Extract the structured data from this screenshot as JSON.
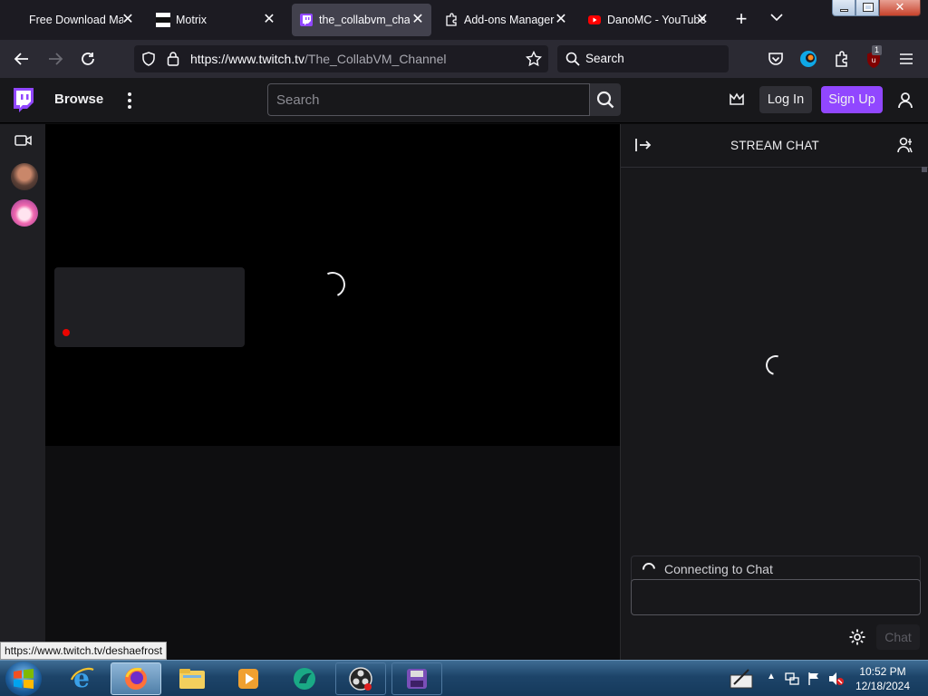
{
  "browser": {
    "tabs": [
      {
        "title": "Free Download Ma",
        "active": false
      },
      {
        "title": "Motrix",
        "active": false
      },
      {
        "title": "the_collabvm_chan",
        "active": true
      },
      {
        "title": "Add-ons Manager",
        "active": false
      },
      {
        "title": "DanoMC - YouTube",
        "active": false
      }
    ],
    "close_glyph": "✕",
    "new_tab_glyph": "+",
    "url_domain": "https://www.twitch.tv",
    "url_path": "/The_CollabVM_Channel",
    "search_label": "Search",
    "extension_badge": "1",
    "status_url": "https://www.twitch.tv/deshaefrost"
  },
  "twitch": {
    "browse_label": "Browse",
    "search_placeholder": "Search",
    "login_label": "Log In",
    "signup_label": "Sign Up",
    "accent_color": "#9147ff"
  },
  "chat": {
    "title": "STREAM CHAT",
    "connecting_text": "Connecting to Chat",
    "chat_button": "Chat"
  },
  "taskbar": {
    "time": "10:52 PM",
    "date": "12/18/2024"
  },
  "icons": [
    "back-arrow-icon",
    "forward-arrow-icon",
    "reload-icon",
    "shield-icon",
    "lock-icon",
    "star-icon",
    "search-icon",
    "pocket-icon",
    "firefox-account-icon",
    "extensions-icon",
    "ublock-icon",
    "menu-icon",
    "twitch-logo-icon",
    "kebab-menu-icon",
    "crown-icon",
    "user-icon",
    "video-camera-icon",
    "collapse-chat-icon",
    "community-icon",
    "gear-icon",
    "windows-start-icon",
    "ie-icon",
    "firefox-icon",
    "explorer-icon",
    "media-player-icon",
    "obs-icon",
    "floppy-icon"
  ]
}
